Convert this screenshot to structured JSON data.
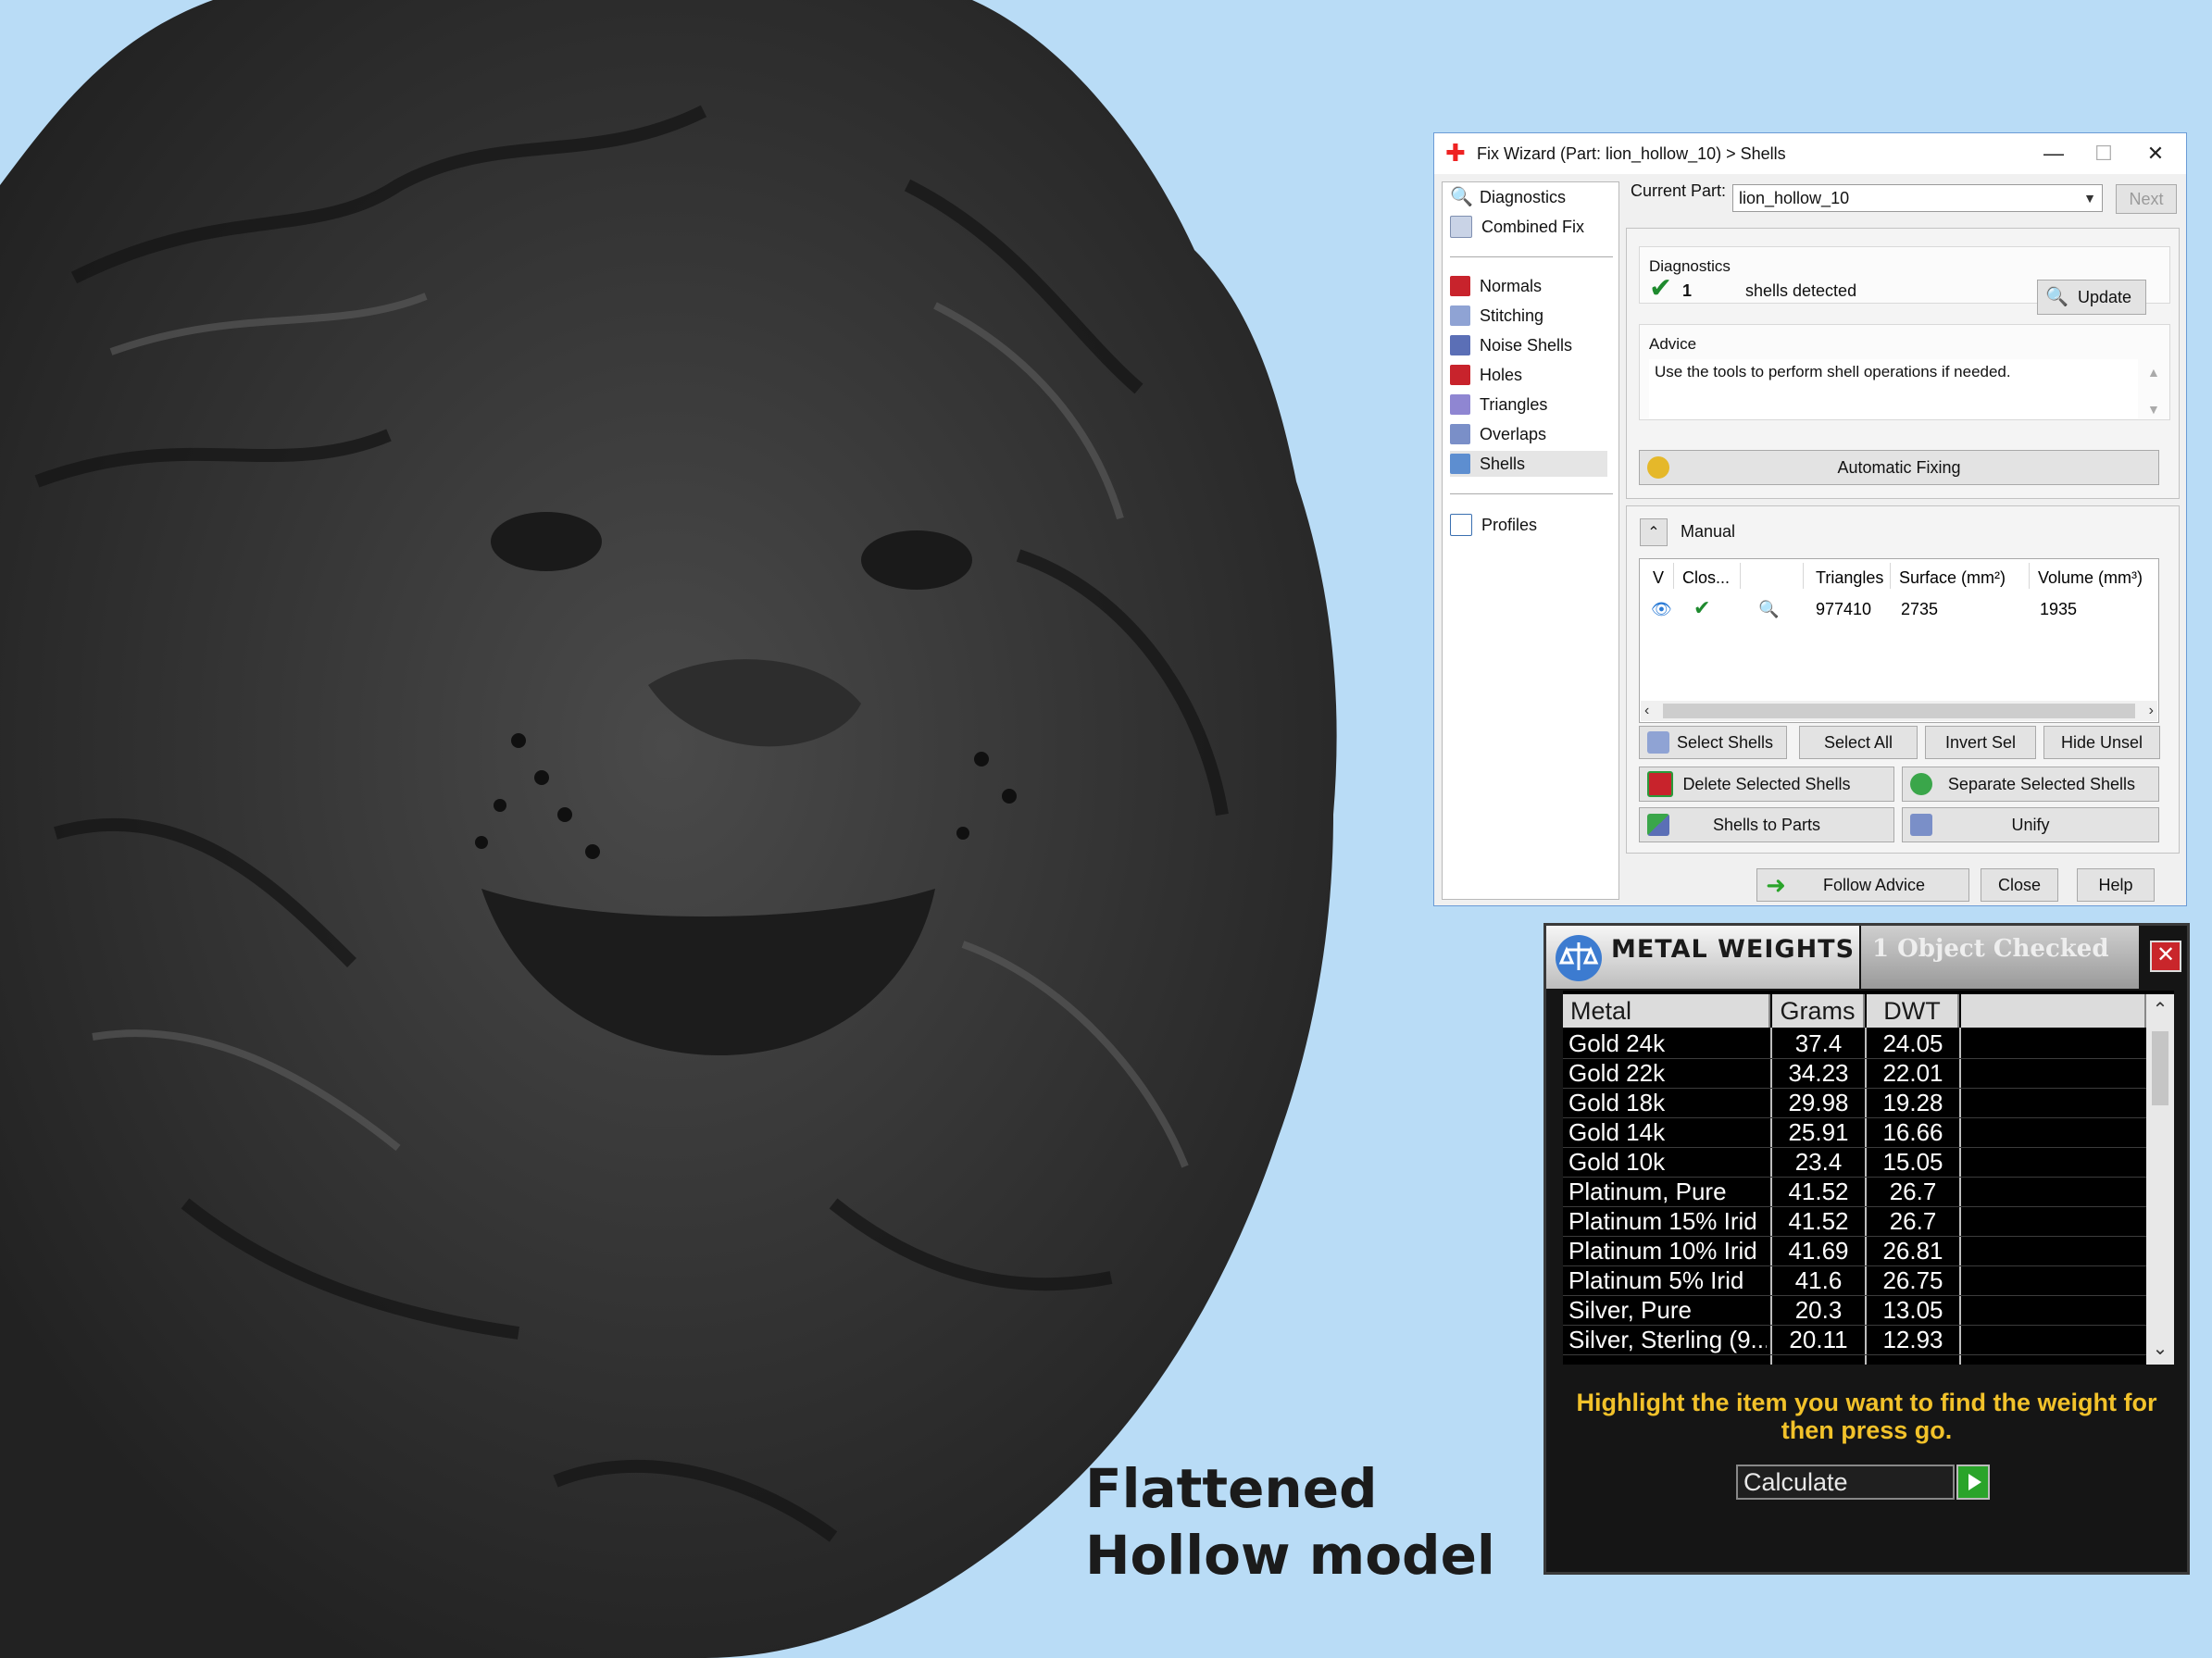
{
  "caption": {
    "line1": "Flattened",
    "line2": "Hollow model"
  },
  "fix_wizard": {
    "title": "Fix Wizard (Part: lion_hollow_10) > Shells",
    "nav_top": [
      "Diagnostics",
      "Combined Fix"
    ],
    "nav_fix": [
      "Normals",
      "Stitching",
      "Noise Shells",
      "Holes",
      "Triangles",
      "Overlaps",
      "Shells"
    ],
    "nav_bottom": [
      "Profiles"
    ],
    "selected_nav": "Shells",
    "current_part_label": "Current Part:",
    "current_part_value": "lion_hollow_10",
    "next_button": "Next",
    "diagnostics": {
      "heading": "Diagnostics",
      "count": "1",
      "status": "shells detected",
      "update_button": "Update"
    },
    "advice": {
      "heading": "Advice",
      "text": "Use the tools to perform shell operations if needed."
    },
    "automatic_fixing": "Automatic Fixing",
    "manual_heading": "Manual",
    "shell_table": {
      "columns": [
        "V",
        "Clos...",
        "",
        "Triangles",
        "Surface (mm²)",
        "Volume (mm³)"
      ],
      "rows": [
        {
          "triangles": "977410",
          "surface": "2735",
          "volume": "1935"
        }
      ]
    },
    "buttons": {
      "select_shells": "Select Shells",
      "select_all": "Select All",
      "invert_sel": "Invert Sel",
      "hide_unsel": "Hide Unsel",
      "delete_selected": "Delete Selected Shells",
      "separate_selected": "Separate Selected Shells",
      "shells_to_parts": "Shells to Parts",
      "unify": "Unify",
      "follow_advice": "Follow Advice",
      "close": "Close",
      "help": "Help"
    }
  },
  "metal_weights": {
    "title": "METAL WEIGHTS",
    "subtitle": "1 Object Checked",
    "columns": [
      "Metal",
      "Grams",
      "DWT"
    ],
    "rows": [
      {
        "metal": "Gold 24k",
        "grams": "37.4",
        "dwt": "24.05"
      },
      {
        "metal": "Gold 22k",
        "grams": "34.23",
        "dwt": "22.01"
      },
      {
        "metal": "Gold 18k",
        "grams": "29.98",
        "dwt": "19.28"
      },
      {
        "metal": "Gold 14k",
        "grams": "25.91",
        "dwt": "16.66"
      },
      {
        "metal": "Gold 10k",
        "grams": "23.4",
        "dwt": "15.05"
      },
      {
        "metal": "Platinum, Pure",
        "grams": "41.52",
        "dwt": "26.7"
      },
      {
        "metal": "Platinum 15% Irid",
        "grams": "41.52",
        "dwt": "26.7"
      },
      {
        "metal": "Platinum 10% Irid",
        "grams": "41.69",
        "dwt": "26.81"
      },
      {
        "metal": "Platinum 5% Irid",
        "grams": "41.6",
        "dwt": "26.75"
      },
      {
        "metal": "Silver, Pure",
        "grams": "20.3",
        "dwt": "13.05"
      },
      {
        "metal": "Silver, Sterling (9...",
        "grams": "20.11",
        "dwt": "12.93"
      }
    ],
    "hint": "Highlight the item you want to find the weight for then press go.",
    "calculate": "Calculate"
  }
}
